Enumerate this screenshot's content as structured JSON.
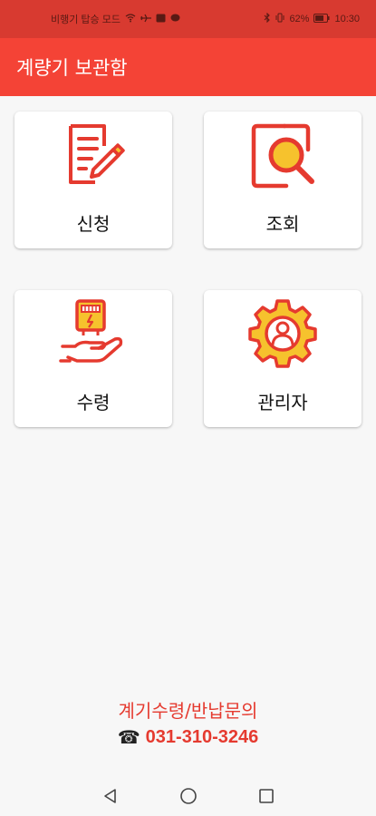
{
  "status_bar": {
    "left_text": "비행기 탑승 모드",
    "battery": "62%",
    "time": "10:30"
  },
  "app": {
    "title": "계량기 보관함"
  },
  "menu": {
    "apply": {
      "label": "신청",
      "icon": "document-pen-icon"
    },
    "inquiry": {
      "label": "조회",
      "icon": "search-magnifier-icon"
    },
    "receive": {
      "label": "수령",
      "icon": "hand-meter-icon"
    },
    "admin": {
      "label": "관리자",
      "icon": "gear-user-icon"
    }
  },
  "contact": {
    "title": "계기수령/반납문의",
    "phone_symbol": "☎",
    "phone": "031-310-3246"
  },
  "colors": {
    "app_bar": "#f44336",
    "status_bar": "#d83a30",
    "accent": "#e53a2f",
    "icon_yellow": "#f6c22d"
  }
}
